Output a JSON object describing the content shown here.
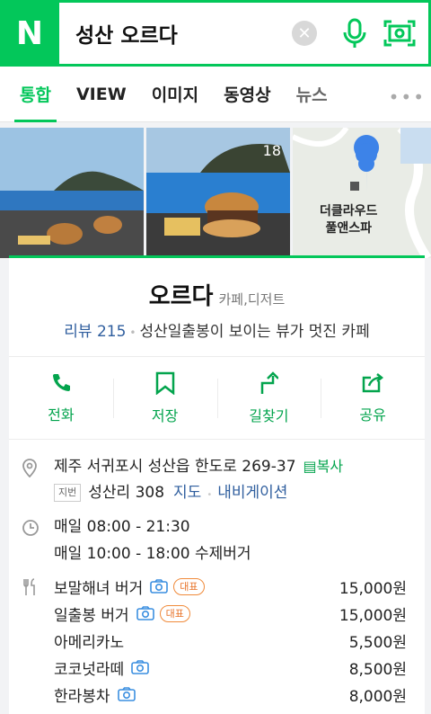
{
  "search": {
    "logo": "N",
    "query": "성산 오르다"
  },
  "tabs": [
    {
      "label": "통합"
    },
    {
      "label": "VIEW"
    },
    {
      "label": "이미지"
    },
    {
      "label": "동영상"
    },
    {
      "label": "뉴스"
    }
  ],
  "photos": {
    "count": "18",
    "map_label_line1": "더클라우드",
    "map_label_line2": "풀앤스파"
  },
  "place": {
    "name": "오르다",
    "category": "카페,디저트",
    "review": "리뷰 215",
    "description": "성산일출봉이 보이는 뷰가 멋진 카페"
  },
  "actions": [
    {
      "label": "전화",
      "icon": "phone-icon"
    },
    {
      "label": "저장",
      "icon": "bookmark-icon"
    },
    {
      "label": "길찾기",
      "icon": "directions-icon"
    },
    {
      "label": "공유",
      "icon": "share-icon"
    }
  ],
  "address": {
    "road": "제주 서귀포시 성산읍 한도로 269-37",
    "copy": "복사",
    "jibun_tag": "지번",
    "jibun": "성산리 308",
    "map_link": "지도",
    "nav_link": "내비게이션"
  },
  "hours": {
    "line1": "매일 08:00 - 21:30",
    "line2": "매일 10:00 - 18:00 수제버거"
  },
  "menu": [
    {
      "name": "보말해녀 버거",
      "price": "15,000원",
      "photo": true,
      "badge": "대표"
    },
    {
      "name": "일출봉 버거",
      "price": "15,000원",
      "photo": true,
      "badge": "대표"
    },
    {
      "name": "아메리카노",
      "price": "5,500원",
      "photo": false,
      "badge": ""
    },
    {
      "name": "코코넛라떼",
      "price": "8,500원",
      "photo": true,
      "badge": ""
    },
    {
      "name": "한라봉차",
      "price": "8,000원",
      "photo": true,
      "badge": ""
    }
  ],
  "colors": {
    "brand": "#03c75a",
    "link": "#2f5e9e",
    "badge": "#e8742a"
  }
}
